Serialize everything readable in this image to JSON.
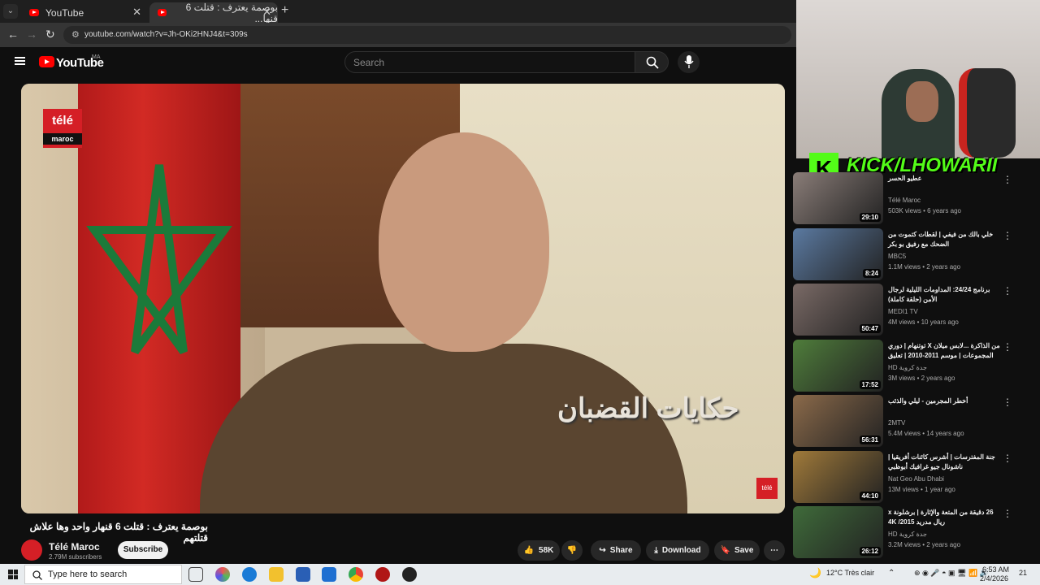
{
  "browser": {
    "tabs": [
      {
        "label": "YouTube"
      },
      {
        "label": "بوصمة يعترف : قتلت 6 قنها..."
      }
    ],
    "url": "youtube.com/watch?v=Jh-OKi2HNJ4&t=309s",
    "new_tab": "+"
  },
  "youtube": {
    "logo_text": "YouTube",
    "country": "MA",
    "search_placeholder": "Search"
  },
  "video": {
    "title": "بوصمة يعترف : قتلت 6 قنهار واحد وها علاش قتلتهم",
    "channel": "Télé Maroc",
    "subscribers": "2.79M subscribers",
    "subscribe_label": "Subscribe",
    "likes": "58K",
    "share_label": "Share",
    "download_label": "Download",
    "save_label": "Save",
    "logo_top": "télé",
    "logo_bottom": "maroc",
    "watermark": "حكايات القضبان"
  },
  "overlay": {
    "kick_text": "KICK/LHOWARII"
  },
  "sidebar": {
    "items": [
      {
        "title": "عطيو الحسر",
        "channel": "Télé Maroc",
        "meta": "503K views • 6 years ago",
        "duration": "29:10",
        "color": "#8a7d78"
      },
      {
        "title": "خلي بالك من فيفي | لقطات كتموت من الضحك مع رفيق بو بكر",
        "channel": "MBC5",
        "meta": "1.1M views • 2 years ago",
        "duration": "8:24",
        "color": "#5b7aa1"
      },
      {
        "title": "برنامج 24/24: المداومات الليلية لرجال الأمن (حلقة كاملة)",
        "channel": "MEDI1 TV",
        "meta": "4M views • 10 years ago",
        "duration": "50:47",
        "color": "#7a6a66"
      },
      {
        "title": "من الذاكرة ...لابس ميلان X توتنهام | دوري المجموعات | موسم 2011-2010 | تعليق",
        "channel": "HD جدة كروية",
        "meta": "3M views • 2 years ago",
        "duration": "17:52",
        "color": "#4f7d3b"
      },
      {
        "title": "أخطر المجرمين - ليلي والذئب",
        "channel": "2MTV",
        "meta": "5.4M views • 14 years ago",
        "duration": "56:31",
        "color": "#8b6a4a"
      },
      {
        "title": "جنة المفترسات | أشرس كائنات أفريقيا | ناشونال جيو غرافيك أبوظبي",
        "channel": "Nat Geo Abu Dhabi",
        "meta": "13M views • 1 year ago",
        "duration": "44:10",
        "color": "#a07a3a"
      },
      {
        "title": "26 دقيقة من المتعة والإثارة | برشلونة x ريال مدريد 2015/ 4K",
        "channel": "HD جدة كروية",
        "meta": "3.2M views • 2 years ago",
        "duration": "26:12",
        "color": "#3f6b3a"
      }
    ]
  },
  "taskbar": {
    "search_placeholder": "Type here to search",
    "weather": "12°C  Très clair",
    "time": "6:53 AM",
    "date": "2/4/2026",
    "notifications": "21"
  }
}
